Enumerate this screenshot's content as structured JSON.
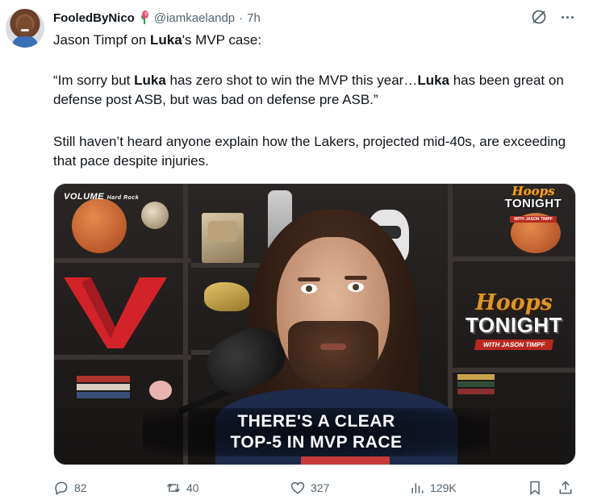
{
  "tweet": {
    "display_name": "FooledByNico",
    "handle": "@iamkaelandp",
    "separator": "·",
    "time": "7h",
    "text_line1_a": "Jason Timpf on ",
    "text_line1_b": "Luka",
    "text_line1_c": "'s MVP case:",
    "quote_a": "“Im sorry but ",
    "quote_b": "Luka",
    "quote_c": " has zero shot to win the MVP this year…",
    "quote_d": "Luka",
    "quote_e": " has been great on defense post ASB, but was bad on defense pre ASB.”",
    "paragraph3": "Still haven’t heard anyone explain how the Lakers, projected mid-40s, are exceeding that pace despite injuries."
  },
  "media": {
    "brand_tl": "VOLUME",
    "brand_tl_sub": "Hard Rock",
    "brand_tr_hoops": "Hoops",
    "brand_tr_tonight": "TONIGHT",
    "brand_tr_sub": "WITH JASON TIMPF",
    "wall_hoops": "Hoops",
    "wall_tonight": "TONIGHT",
    "wall_sub": "WITH JASON TIMPF",
    "caption_line1": "THERE'S A CLEAR",
    "caption_line2": "TOP-5 IN MVP RACE"
  },
  "actions": {
    "replies": "82",
    "retweets": "40",
    "likes": "327",
    "views": "129K"
  },
  "icons": {
    "badge": "flower-badge-icon",
    "grok": "grok-icon",
    "more": "more-icon",
    "reply": "reply-icon",
    "retweet": "retweet-icon",
    "like": "heart-icon",
    "views": "views-icon",
    "bookmark": "bookmark-icon",
    "share": "share-icon"
  },
  "colors": {
    "text": "#0f1419",
    "secondary": "#536471",
    "brand_orange": "#f2a22c",
    "brand_red": "#b8281f"
  }
}
